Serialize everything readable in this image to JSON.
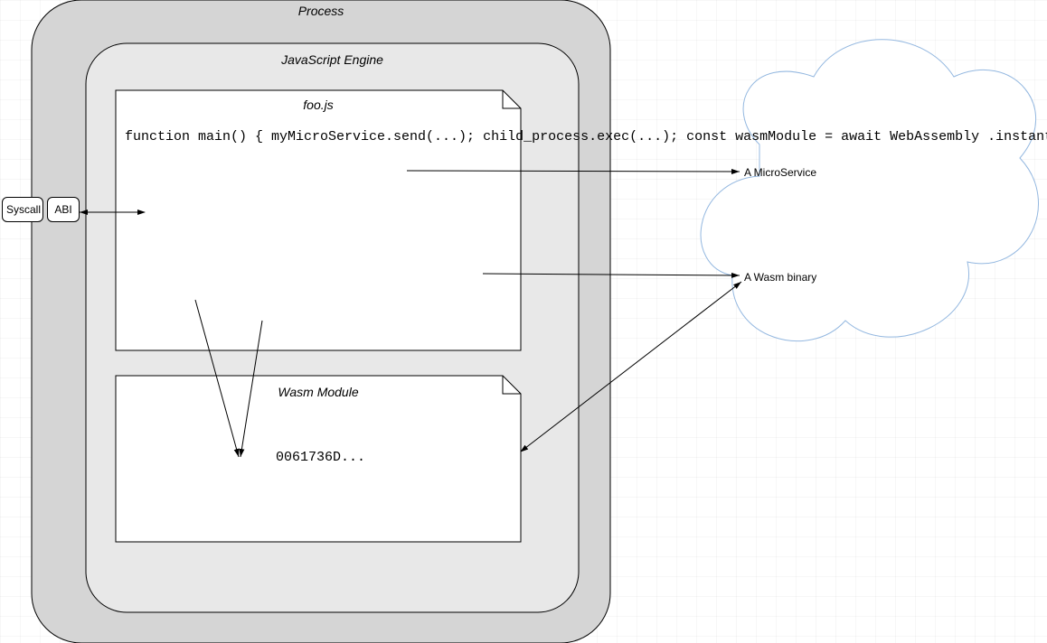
{
  "process": {
    "title": "Process"
  },
  "jsengine": {
    "title": "JavaScript Engine"
  },
  "foo": {
    "title": "foo.js",
    "code": "function main() {\n  myMicroService.send(...);\n\n  child_process.exec(...);\n\n  const wasmModule = await WebAssembly\n    .instantiateStreaming(fetch(...));\n  let x = wasmModule.instance.\n    exports.f();\n}"
  },
  "wasm": {
    "title": "Wasm Module",
    "hex": "0061736D..."
  },
  "syscall": {
    "label": "Syscall"
  },
  "abi": {
    "label": "ABI"
  },
  "cloud": {
    "microservice": "A MicroService",
    "wasmbinary": "A Wasm binary"
  }
}
